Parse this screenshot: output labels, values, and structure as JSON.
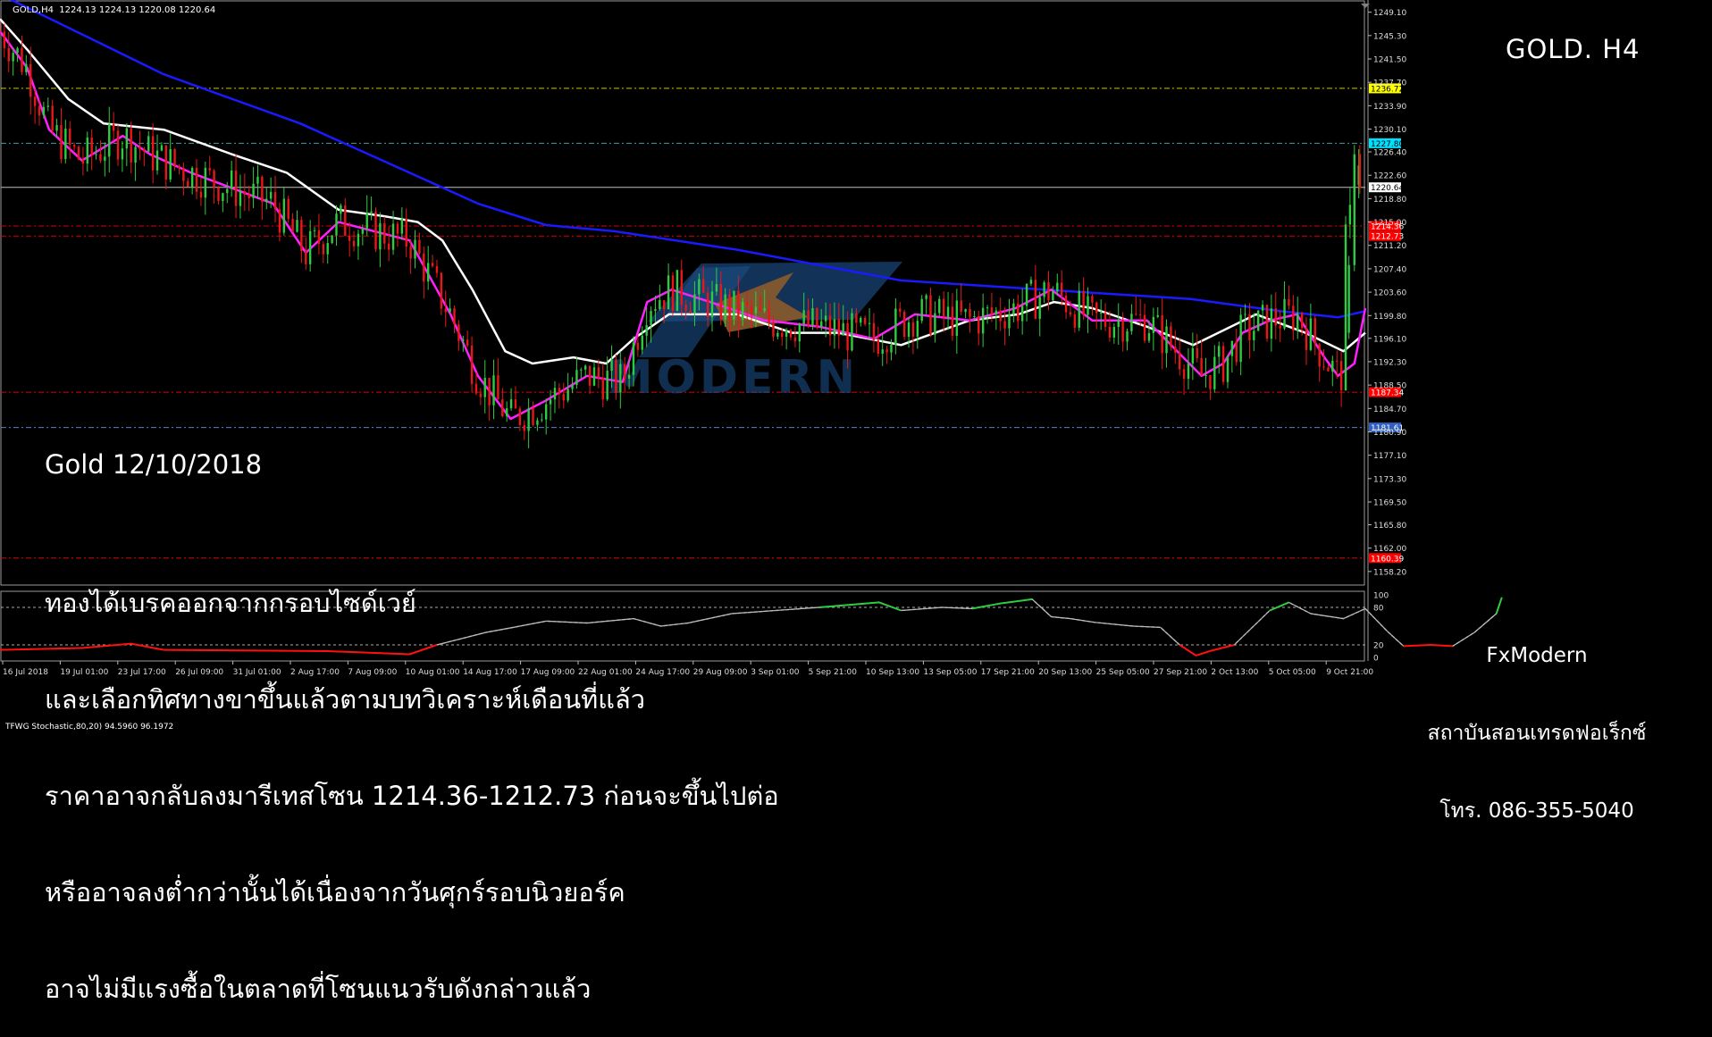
{
  "header": {
    "symbol_info": "GOLD,H4  1224.13 1224.13 1220.08 1220.64"
  },
  "title": "GOLD. H4",
  "date_label": "Gold 12/10/2018",
  "analysis_lines": [
    "ทองได้เบรคออกจากกรอบไซด์เวย์",
    "และเลือกทิศทางขาขึ้นแล้วตามบทวิเคราะห์เดือนที่แล้ว",
    "ราคาอาจกลับลงมารีเทสโซน 1214.36-1212.73 ก่อนจะขึ้นไปต่อ",
    "หรืออาจลงต่ำกว่านั้นได้เนื่องจากวันศุกร์รอบนิวยอร์ค",
    "อาจไม่มีแรงซื้อในตลาดที่โซนแนวรับดังกล่าวแล้ว"
  ],
  "company": {
    "name": "FxModern",
    "subtitle": "สถาบันสอนเทรดฟอเร็กซ์",
    "phone": "โทร. 086-355-5040"
  },
  "watermark": {
    "text": "MODERN"
  },
  "stochastic": {
    "label": "TFWG Stochastic,80,20) 94.5960 96.1972",
    "levels": [
      100,
      80,
      20,
      0
    ]
  },
  "chart_data": {
    "type": "candlestick",
    "symbol": "GOLD",
    "timeframe": "H4",
    "ylim": [
      1156.0,
      1250.5
    ],
    "price_ticks": [
      "1249.10",
      "1245.30",
      "1241.50",
      "1237.70",
      "1233.90",
      "1230.10",
      "1226.40",
      "1222.60",
      "1218.80",
      "1215.00",
      "1211.20",
      "1207.40",
      "1203.60",
      "1199.80",
      "1196.10",
      "1192.30",
      "1188.50",
      "1184.70",
      "1180.90",
      "1177.10",
      "1173.30",
      "1169.50",
      "1165.80",
      "1162.00",
      "1158.20"
    ],
    "date_ticks": [
      "16 Jul 2018",
      "19 Jul 01:00",
      "23 Jul 17:00",
      "26 Jul 09:00",
      "31 Jul 01:00",
      "2 Aug 17:00",
      "7 Aug 09:00",
      "10 Aug 01:00",
      "14 Aug 17:00",
      "17 Aug 09:00",
      "22 Aug 01:00",
      "24 Aug 17:00",
      "29 Aug 09:00",
      "3 Sep 01:00",
      "5 Sep 21:00",
      "10 Sep 13:00",
      "13 Sep 05:00",
      "17 Sep 21:00",
      "20 Sep 13:00",
      "25 Sep 05:00",
      "27 Sep 21:00",
      "2 Oct 13:00",
      "5 Oct 05:00",
      "9 Oct 21:00"
    ],
    "levels": [
      {
        "price": 1236.72,
        "label": "1236.72",
        "color": "#c8c800",
        "label_bg": "#ffff00",
        "label_fg": "#000000"
      },
      {
        "price": 1227.8,
        "label": "1227.80",
        "color": "#40a0a0",
        "label_bg": "#00e0ff",
        "label_fg": "#000000"
      },
      {
        "price": 1220.64,
        "label": "1220.64",
        "color": "#c0c0c0",
        "label_bg": "#ffffff",
        "label_fg": "#000000"
      },
      {
        "price": 1214.36,
        "label": "1214.36",
        "color": "#e00000",
        "label_bg": "#ff0000",
        "label_fg": "#ffffff"
      },
      {
        "price": 1212.73,
        "label": "1212.73",
        "color": "#e00000",
        "label_bg": "#ff0000",
        "label_fg": "#ffffff"
      },
      {
        "price": 1187.34,
        "label": "1187.34",
        "color": "#e00000",
        "label_bg": "#ff0000",
        "label_fg": "#ffffff"
      },
      {
        "price": 1181.61,
        "label": "1181.61",
        "color": "#6080c0",
        "label_bg": "#3060c0",
        "label_fg": "#ffffff"
      },
      {
        "price": 1160.39,
        "label": "1160.39",
        "color": "#e00000",
        "label_bg": "#ff0000",
        "label_fg": "#ffffff"
      }
    ],
    "series": [
      {
        "name": "MA slow",
        "color": "#1a1aff",
        "points": [
          [
            0,
            1252
          ],
          [
            60,
            1239
          ],
          [
            110,
            1231
          ],
          [
            150,
            1223
          ],
          [
            175,
            1218
          ],
          [
            200,
            1214.5
          ],
          [
            225,
            1213.5
          ],
          [
            270,
            1210.5
          ],
          [
            330,
            1205.5
          ],
          [
            400,
            1203.5
          ],
          [
            436,
            1202.5
          ],
          [
            469,
            1200.5
          ],
          [
            490,
            1199.5
          ],
          [
            500,
            1200.5
          ]
        ]
      },
      {
        "name": "MA medium",
        "color": "#ffffff",
        "points": [
          [
            0,
            1248
          ],
          [
            10,
            1243
          ],
          [
            25,
            1235
          ],
          [
            38,
            1231
          ],
          [
            60,
            1230
          ],
          [
            85,
            1226
          ],
          [
            105,
            1223
          ],
          [
            124,
            1217
          ],
          [
            140,
            1216
          ],
          [
            153,
            1215
          ],
          [
            162,
            1212
          ],
          [
            173,
            1204
          ],
          [
            185,
            1194
          ],
          [
            195,
            1192
          ],
          [
            210,
            1193
          ],
          [
            222,
            1192
          ],
          [
            232,
            1196
          ],
          [
            245,
            1200
          ],
          [
            270,
            1200
          ],
          [
            290,
            1197
          ],
          [
            307,
            1197
          ],
          [
            330,
            1195
          ],
          [
            355,
            1199
          ],
          [
            373,
            1200
          ],
          [
            386,
            1202
          ],
          [
            400,
            1201
          ],
          [
            420,
            1198
          ],
          [
            437,
            1195
          ],
          [
            460,
            1200
          ],
          [
            478,
            1197
          ],
          [
            492,
            1194
          ],
          [
            500,
            1197
          ]
        ]
      },
      {
        "name": "MA fast",
        "color": "#ff20ff",
        "points": [
          [
            0,
            1246
          ],
          [
            10,
            1240
          ],
          [
            18,
            1230
          ],
          [
            30,
            1225
          ],
          [
            45,
            1229
          ],
          [
            55,
            1226
          ],
          [
            70,
            1223
          ],
          [
            100,
            1218
          ],
          [
            112,
            1210
          ],
          [
            124,
            1215
          ],
          [
            150,
            1212
          ],
          [
            165,
            1200
          ],
          [
            175,
            1190
          ],
          [
            187,
            1183
          ],
          [
            200,
            1186
          ],
          [
            215,
            1190
          ],
          [
            228,
            1189
          ],
          [
            237,
            1202
          ],
          [
            246,
            1204
          ],
          [
            260,
            1202
          ],
          [
            280,
            1199
          ],
          [
            300,
            1198
          ],
          [
            320,
            1196
          ],
          [
            335,
            1200
          ],
          [
            355,
            1199
          ],
          [
            372,
            1201
          ],
          [
            385,
            1204
          ],
          [
            400,
            1199
          ],
          [
            420,
            1199
          ],
          [
            440,
            1190
          ],
          [
            448,
            1192
          ],
          [
            455,
            1197
          ],
          [
            465,
            1199
          ],
          [
            475,
            1200
          ],
          [
            485,
            1193
          ],
          [
            490,
            1190
          ],
          [
            496,
            1192
          ],
          [
            500,
            1201
          ]
        ]
      }
    ],
    "stochastic_values": [
      [
        0,
        12
      ],
      [
        30,
        15
      ],
      [
        48,
        22
      ],
      [
        60,
        12
      ],
      [
        120,
        10
      ],
      [
        150,
        5
      ],
      [
        160,
        20
      ],
      [
        178,
        40
      ],
      [
        188,
        48
      ],
      [
        200,
        58
      ],
      [
        215,
        55
      ],
      [
        232,
        62
      ],
      [
        242,
        50
      ],
      [
        252,
        55
      ],
      [
        268,
        70
      ],
      [
        300,
        80
      ],
      [
        322,
        88
      ],
      [
        330,
        75
      ],
      [
        345,
        80
      ],
      [
        356,
        78
      ],
      [
        366,
        86
      ],
      [
        378,
        93
      ],
      [
        385,
        65
      ],
      [
        392,
        62
      ],
      [
        401,
        56
      ],
      [
        415,
        50
      ],
      [
        425,
        48
      ],
      [
        432,
        20
      ],
      [
        438,
        3
      ],
      [
        443,
        10
      ],
      [
        452,
        20
      ],
      [
        465,
        75
      ],
      [
        472,
        88
      ],
      [
        480,
        70
      ],
      [
        492,
        62
      ],
      [
        500,
        78
      ],
      [
        508,
        42
      ],
      [
        514,
        18
      ],
      [
        524,
        20
      ],
      [
        532,
        18
      ],
      [
        540,
        40
      ],
      [
        548,
        70
      ],
      [
        550,
        96
      ]
    ]
  }
}
